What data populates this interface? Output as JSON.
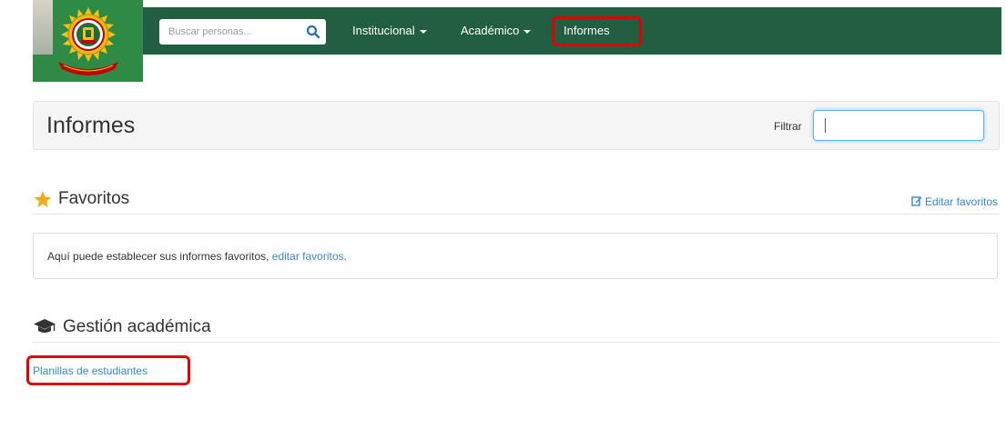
{
  "navbar": {
    "search_placeholder": "Buscar personas...",
    "items": [
      {
        "label": "Institucional",
        "has_caret": true
      },
      {
        "label": "Académico",
        "has_caret": true
      },
      {
        "label": "Informes",
        "has_caret": false
      }
    ],
    "color": "#225e42"
  },
  "page": {
    "title": "Informes",
    "filter_label": "Filtrar",
    "filter_value": ""
  },
  "favorites": {
    "title": "Favoritos",
    "edit_label": "Editar favoritos",
    "message": "Aquí puede establecer sus informes favoritos, ",
    "message_link": "editar favoritos",
    "message_end": "."
  },
  "academic": {
    "title": "Gestión académica",
    "reports": [
      "Planillas de estudiantes"
    ]
  },
  "colors": {
    "link": "#3a87c8",
    "highlight": "#e00000",
    "star": "#f0ad1e"
  }
}
